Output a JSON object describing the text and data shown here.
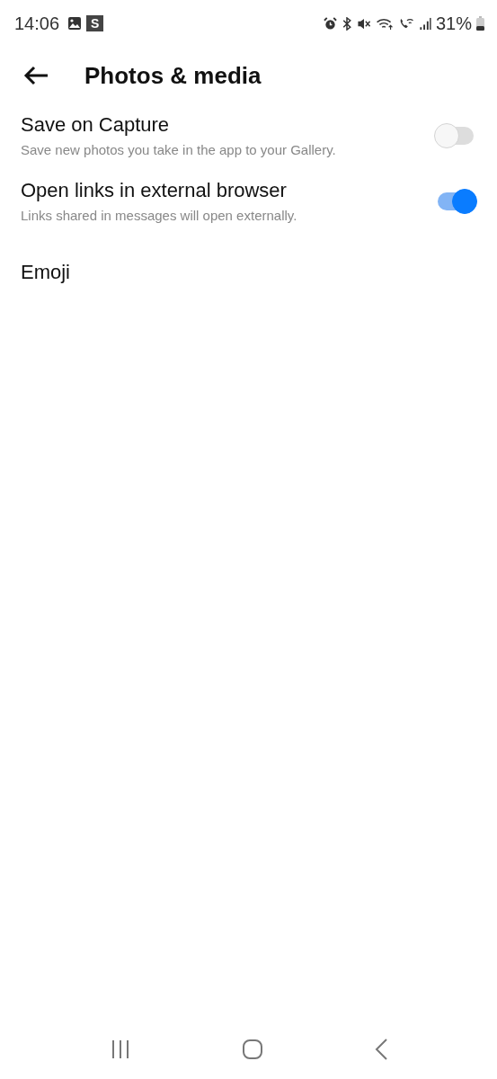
{
  "status_bar": {
    "time": "14:06",
    "badge": "S",
    "battery": "31%"
  },
  "header": {
    "title": "Photos & media"
  },
  "settings": [
    {
      "kind": "toggle",
      "title": "Save on Capture",
      "subtitle": "Save new photos you take in the app to your Gallery.",
      "on": false
    },
    {
      "kind": "toggle",
      "title": "Open links in external browser",
      "subtitle": "Links shared in messages will open externally.",
      "on": true
    },
    {
      "kind": "link",
      "title": "Emoji"
    }
  ]
}
